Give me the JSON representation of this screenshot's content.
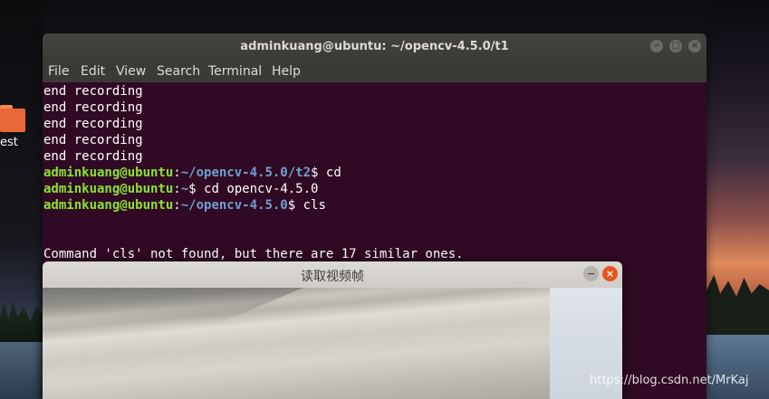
{
  "desktop": {
    "folder_label": "est",
    "watermark": "https://blog.csdn.net/MrKaj"
  },
  "terminal": {
    "title": "adminkuang@ubuntu: ~/opencv-4.5.0/t1",
    "menu": [
      "File",
      "Edit",
      "View",
      "Search",
      "Terminal",
      "Help"
    ],
    "lines": [
      {
        "text": "end recording"
      },
      {
        "text": "end recording"
      },
      {
        "text": "end recording"
      },
      {
        "text": "end recording"
      },
      {
        "text": "end recording"
      },
      {
        "user": "adminkuang@ubuntu",
        "sep": ":",
        "path": "~/opencv-4.5.0/t2",
        "cmd": "$ cd"
      },
      {
        "user": "adminkuang@ubuntu",
        "sep": ":",
        "path": "~",
        "cmd": "$ cd opencv-4.5.0"
      },
      {
        "user": "adminkuang@ubuntu",
        "sep": ":",
        "path": "~/opencv-4.5.0",
        "cmd": "$ cls"
      },
      {
        "text": ""
      },
      {
        "text": "Command 'cls' not found, but there are 17 similar ones."
      }
    ]
  },
  "video_window": {
    "title": "读取视频帧"
  },
  "colors": {
    "terminal_bg": "#300a24",
    "prompt_user": "#8ae234",
    "prompt_path": "#729fcf",
    "close_button": "#e95420"
  }
}
